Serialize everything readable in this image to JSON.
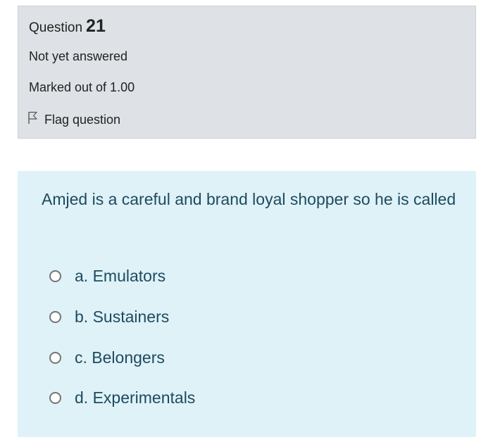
{
  "question": {
    "label": "Question",
    "number": "21",
    "state": "Not yet answered",
    "grade": "Marked out of 1.00",
    "flag_label": "Flag question"
  },
  "content": {
    "text": "Amjed is a careful and brand loyal shopper so he is called",
    "answers": [
      {
        "label": "a. Emulators"
      },
      {
        "label": "b. Sustainers"
      },
      {
        "label": "c. Belongers"
      },
      {
        "label": "d. Experimentals"
      }
    ]
  },
  "colors": {
    "info_bg": "#dee2e6",
    "content_bg": "#def2f8",
    "content_text": "#1f4a5e"
  }
}
